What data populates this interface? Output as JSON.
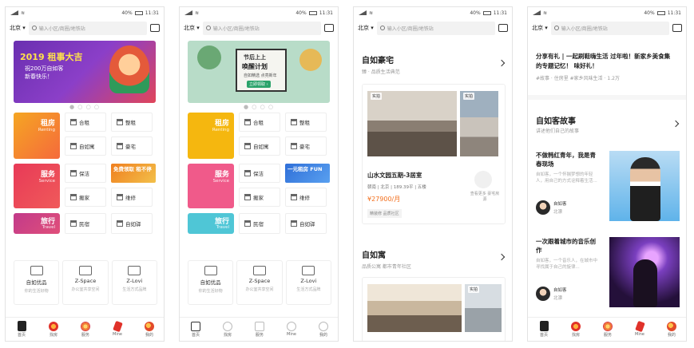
{
  "status": {
    "time": "11:31",
    "battery_pct": "40%"
  },
  "common": {
    "city": "北京 ▾",
    "search_placeholder": "输入小区/商圈/地铁站"
  },
  "home": {
    "banner1": {
      "title": "2019 租事大吉",
      "line1": "祝200万自如客",
      "line2": "新春快乐！"
    },
    "banner2": {
      "line1": "节后上上",
      "line2": "唤醒计划",
      "sub": "自如精选 点亮新年",
      "btn": "立即领取 ›"
    },
    "dots": "● ○ ○ ○",
    "categories": [
      {
        "name": "租房",
        "en": "Renting"
      },
      {
        "name": "服务",
        "en": "Service"
      },
      {
        "name": "旅行",
        "en": "Travel"
      }
    ],
    "tiles": [
      "合租",
      "整租",
      "自如寓",
      "豪宅",
      "保洁",
      "搬家",
      "维修",
      "民宿",
      "自如驿"
    ],
    "promo1": "免费领取\n租不停",
    "promo2": "一元租房\nFUN",
    "zitems": [
      {
        "name": "自如优品",
        "sub": "你的生活好物"
      },
      {
        "name": "Z-Space",
        "sub": "办公室共享空间"
      },
      {
        "name": "Z-Lovi",
        "sub": "生活方式品牌"
      }
    ]
  },
  "tabs": [
    {
      "label": "首页",
      "icon": "home-icon"
    },
    {
      "label": "找房",
      "icon": "lantern-icon"
    },
    {
      "label": "服务",
      "icon": "lion-icon"
    },
    {
      "label": "Mine",
      "icon": "firecracker-icon"
    },
    {
      "label": "我的",
      "icon": "fish-icon"
    }
  ],
  "tabs_alt": [
    {
      "label": "首页"
    },
    {
      "label": "找房"
    },
    {
      "label": "服务"
    },
    {
      "label": "Mine"
    },
    {
      "label": "我的"
    }
  ],
  "luxury": {
    "title": "自如豪宅",
    "subtitle": "臻 · 品质生活典范",
    "badge1": "实拍",
    "badge2": "实拍",
    "listing": "山水文园五期-3居室",
    "meta": "朝南 | 北京 | 189.39平 | 五楼",
    "price": "¥27900/月",
    "tag": "精装修 品质社区",
    "side_text": "查看更多 豪宅房源"
  },
  "apartment": {
    "title": "自如寓",
    "subtitle": "品质公寓 都市青年社区",
    "badge1": "实拍"
  },
  "stories": {
    "header_line": "分享有礼 | 一起刷鞋嗨生活   过年啦！新家乡美食集",
    "header_line2": "的专题记忆！   味好礼！",
    "tags": "#故事 · 住房里   #家乡风味生活 · 1.2万",
    "section_title": "自如客故事",
    "section_sub": "讲述他们自己的故事",
    "items": [
      {
        "title": "不做韩红青年，我是青春现场",
        "body": "自如客，一个怀揣梦想的年轻人，用自己的方式诠释着生活...",
        "author": "自如客",
        "role": "北漂"
      },
      {
        "title": "一次跟着城市的音乐创作",
        "body": "自如客，一个音乐人，在城市中寻找属于自己的旋律...",
        "author": "自如客",
        "role": "北漂"
      }
    ]
  }
}
